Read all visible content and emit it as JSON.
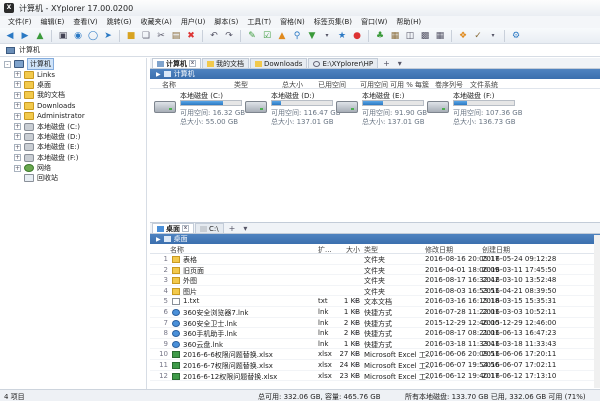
{
  "window": {
    "title": "计算机 - XYplorer 17.00.0200"
  },
  "menu": [
    "文件(F)",
    "编辑(E)",
    "查看(V)",
    "跳转(G)",
    "收藏夹(A)",
    "用户(U)",
    "脚本(S)",
    "工具(T)",
    "窗格(N)",
    "标签页集(B)",
    "窗口(W)",
    "帮助(H)"
  ],
  "address": {
    "value": "计算机"
  },
  "tree": [
    {
      "label": "计算机",
      "icon": "pc",
      "level": 0,
      "exp": "-",
      "selected": true
    },
    {
      "label": "Links",
      "icon": "folder",
      "level": 1,
      "exp": "+"
    },
    {
      "label": "桌面",
      "icon": "folder",
      "level": 1,
      "exp": "+"
    },
    {
      "label": "我的文档",
      "icon": "folder",
      "level": 1,
      "exp": "+"
    },
    {
      "label": "Downloads",
      "icon": "folder",
      "level": 1,
      "exp": "+"
    },
    {
      "label": "Administrator",
      "icon": "folder",
      "level": 1,
      "exp": "+"
    },
    {
      "label": "本地磁盘 (C:)",
      "icon": "drive",
      "level": 1,
      "exp": "+"
    },
    {
      "label": "本地磁盘 (D:)",
      "icon": "drive",
      "level": 1,
      "exp": "+"
    },
    {
      "label": "本地磁盘 (E:)",
      "icon": "drive",
      "level": 1,
      "exp": "+"
    },
    {
      "label": "本地磁盘 (F:)",
      "icon": "drive",
      "level": 1,
      "exp": "+"
    },
    {
      "label": "网络",
      "icon": "net",
      "level": 1,
      "exp": "+"
    },
    {
      "label": "回收站",
      "icon": "bin",
      "level": 1,
      "exp": ""
    }
  ],
  "top_pane": {
    "tabs": [
      {
        "label": "计算机",
        "active": true
      },
      {
        "label": "我的文档",
        "active": false
      },
      {
        "label": "Downloads",
        "active": false
      },
      {
        "label": "E:\\XYplorer\\HP",
        "active": false
      }
    ],
    "breadcrumb": "计算机",
    "columns": [
      "名称",
      "类型",
      "总大小",
      "已用空间",
      "可用空间",
      "可用 %",
      "每簇",
      "卷序列号",
      "文件系统"
    ],
    "drives": [
      {
        "name": "本地磁盘 (C:)",
        "free": "可用空间: 16.32 GB",
        "total": "总大小: 55.00 GB",
        "used_pct": 70
      },
      {
        "name": "本地磁盘 (D:)",
        "free": "可用空间: 116.47 GB",
        "total": "总大小: 137.01 GB",
        "used_pct": 15
      },
      {
        "name": "本地磁盘 (E:)",
        "free": "可用空间: 91.90 GB",
        "total": "总大小: 137.01 GB",
        "used_pct": 33
      },
      {
        "name": "本地磁盘 (F:)",
        "free": "可用空间: 107.36 GB",
        "total": "总大小: 136.73 GB",
        "used_pct": 21
      }
    ]
  },
  "bottom_pane": {
    "tabs": [
      {
        "label": "桌面",
        "active": true
      },
      {
        "label": "C:\\",
        "active": false
      }
    ],
    "breadcrumb": "桌面",
    "columns": [
      "名称",
      "扩...",
      "大小",
      "类型",
      "修改日期",
      "创建日期"
    ],
    "rows": [
      {
        "num": "1",
        "icon": "folder",
        "name": "表格",
        "ext": "",
        "size": "",
        "flag": "",
        "type": "文件夹",
        "modified": "2016-08-16 20:05:17",
        "created": "2016-05-24 09:12:28"
      },
      {
        "num": "2",
        "icon": "folder",
        "name": "旧页面",
        "ext": "",
        "size": "",
        "flag": "",
        "type": "文件夹",
        "modified": "2016-04-01 18:06:09",
        "created": "2016-03-11 17:45:50"
      },
      {
        "num": "3",
        "icon": "folder",
        "name": "外图",
        "ext": "",
        "size": "",
        "flag": "",
        "type": "文件夹",
        "modified": "2016-08-17 16:32:42",
        "created": "2016-03-10 13:52:48"
      },
      {
        "num": "4",
        "icon": "folder",
        "name": "图片",
        "ext": "",
        "size": "",
        "flag": "",
        "type": "文件夹",
        "modified": "2016-08-03 16:53:51",
        "created": "2016-04-21 08:39:50"
      },
      {
        "num": "5",
        "icon": "file",
        "name": "1.txt",
        "ext": "txt",
        "size": "1 KB",
        "flag": "+",
        "type": "文本文档",
        "modified": "2016-03-16 16:15:18",
        "created": "2016-03-15 15:35:31"
      },
      {
        "num": "6",
        "icon": "lnk",
        "name": "360安全浏览器7.lnk",
        "ext": "lnk",
        "size": "1 KB",
        "flag": "+",
        "type": "快捷方式",
        "modified": "2016-07-28 11:22:01",
        "created": "2016-03-03 10:52:11"
      },
      {
        "num": "7",
        "icon": "lnk",
        "name": "360安全卫士.lnk",
        "ext": "lnk",
        "size": "2 KB",
        "flag": "+",
        "type": "快捷方式",
        "modified": "2015-12-29 12:46:00",
        "created": "2015-12-29 12:46:00"
      },
      {
        "num": "8",
        "icon": "lnk",
        "name": "360手机助手.lnk",
        "ext": "lnk",
        "size": "2 KB",
        "flag": "+",
        "type": "快捷方式",
        "modified": "2016-08-17 08:21:01",
        "created": "2016-06-13 16:47:23"
      },
      {
        "num": "9",
        "icon": "lnk",
        "name": "360云盘.lnk",
        "ext": "lnk",
        "size": "1 KB",
        "flag": "+",
        "type": "快捷方式",
        "modified": "2016-03-18 11:33:41",
        "created": "2016-03-18 11:33:43"
      },
      {
        "num": "10",
        "icon": "xlsx",
        "name": "2016-6-6权限问题替换.xlsx",
        "ext": "xlsx",
        "size": "27 KB",
        "flag": "+",
        "type": "Microsoft Excel 工...",
        "modified": "2016-06-06 20:09:51",
        "created": "2016-06-06 17:20:11"
      },
      {
        "num": "11",
        "icon": "xlsx",
        "name": "2016-6-7权限问题替换.xlsx",
        "ext": "xlsx",
        "size": "24 KB",
        "flag": "+",
        "type": "Microsoft Excel 工...",
        "modified": "2016-06-07 19:54:56",
        "created": "2016-06-07 17:02:11"
      },
      {
        "num": "12",
        "icon": "xlsx",
        "name": "2016-6-12权限问题替换.xlsx",
        "ext": "xlsx",
        "size": "23 KB",
        "flag": "+",
        "type": "Microsoft Excel 工...",
        "modified": "2016-06-12 19:40:17",
        "created": "2016-06-12 17:13:10"
      }
    ]
  },
  "status": {
    "items": "4 项目",
    "total": "总可用: 332.06 GB, 容量: 465.76 GB",
    "drive": "所有本地磁盘: 133.70 GB 已用, 332.06 GB 可用 (71%)"
  },
  "colors": {
    "accent": "#3b6fae",
    "selection": "#cfe3f8",
    "drive_bar": "#2b79c4"
  }
}
